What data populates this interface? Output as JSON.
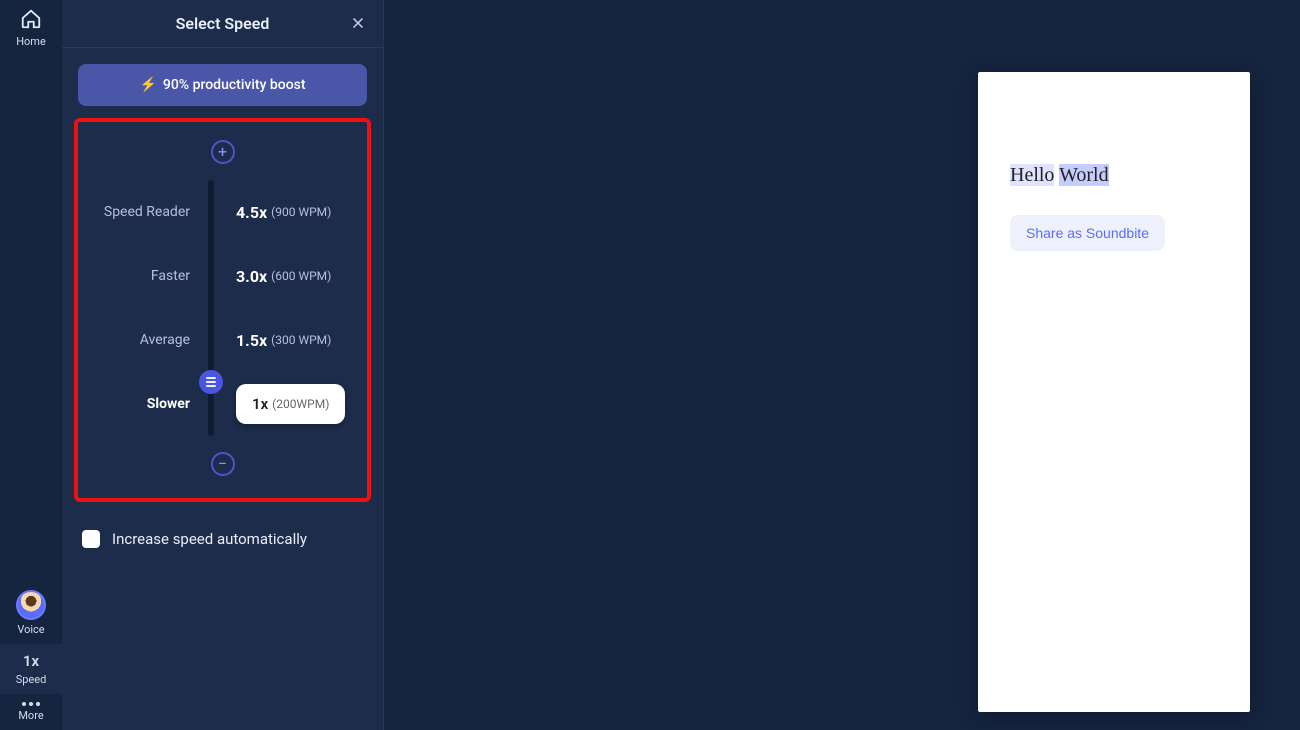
{
  "rail": {
    "home_label": "Home",
    "voice_label": "Voice",
    "speed_value": "1x",
    "speed_label": "Speed",
    "more_label": "More"
  },
  "panel": {
    "title": "Select Speed",
    "boost_emoji": "⚡",
    "boost_text": "90% productivity boost",
    "speeds": [
      {
        "label": "Speed Reader",
        "mult": "4.5x",
        "wpm": "(900 WPM)",
        "bold": false,
        "selected": false
      },
      {
        "label": "Faster",
        "mult": "3.0x",
        "wpm": "(600 WPM)",
        "bold": false,
        "selected": false
      },
      {
        "label": "Average",
        "mult": "1.5x",
        "wpm": "(300 WPM)",
        "bold": false,
        "selected": false
      },
      {
        "label": "Slower",
        "mult": "1x",
        "wpm": "(200WPM)",
        "bold": true,
        "selected": true
      }
    ],
    "auto_label": "Increase speed automatically"
  },
  "doc": {
    "word1": "Hello",
    "word2": "World",
    "share_label": "Share as Soundbite"
  }
}
